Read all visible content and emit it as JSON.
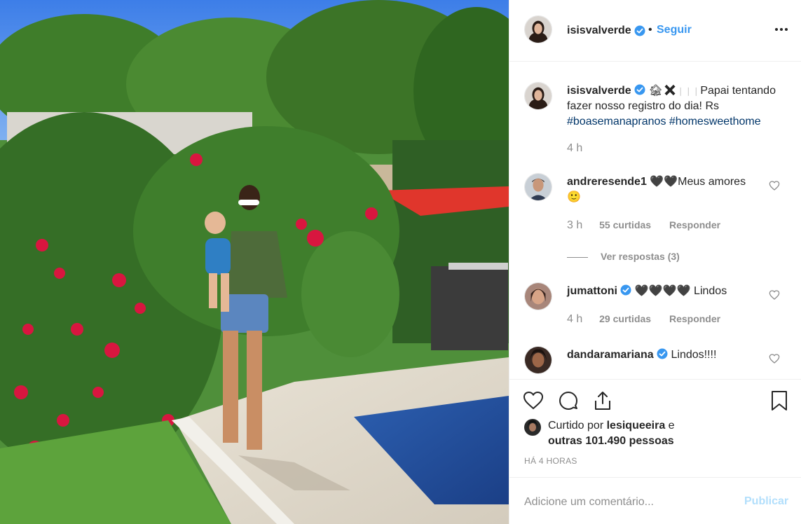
{
  "post": {
    "author": "isisvalverde",
    "separator": "•",
    "follow_label": "Seguir",
    "more_icon": "more-options-icon"
  },
  "caption": {
    "username": "isisvalverde",
    "emoji": "🏚✖",
    "bars": "❘❘❘",
    "text": "Papai tentando fazer nosso registro do dia! Rs",
    "hashtag_1": "#boasemanapranos",
    "hashtag_2": "#homesweethome",
    "time": "4 h"
  },
  "comments": [
    {
      "username": "andreresende1",
      "text": "🖤🖤Meus amores",
      "text_line2": "🙂",
      "time": "3 h",
      "likes": "55 curtidas",
      "reply": "Responder",
      "view_replies": "Ver respostas (3)"
    },
    {
      "username": "jumattoni",
      "text": "🖤🖤🖤🖤 Lindos",
      "time": "4 h",
      "likes": "29 curtidas",
      "reply": "Responder"
    },
    {
      "username": "dandaramariana",
      "text": "Lindos!!!!"
    }
  ],
  "likes": {
    "prefix": "Curtido por",
    "user": "lesiqueeira",
    "connector": "e",
    "others": "outras 101.490 pessoas"
  },
  "timestamp": "HÁ 4 HORAS",
  "add_comment": {
    "placeholder": "Adicione um comentário...",
    "publish_label": "Publicar"
  },
  "colors": {
    "link_blue": "#3897f0",
    "hashtag": "#003569",
    "muted": "#8e8e8e",
    "publish_disabled": "#b2dffc",
    "verified": "#3897f0"
  }
}
